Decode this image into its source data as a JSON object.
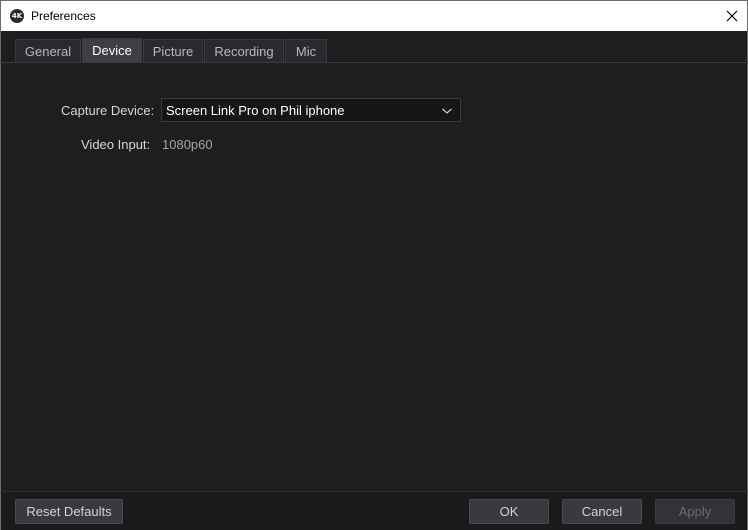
{
  "window": {
    "title": "Preferences",
    "app_icon_text": "4K"
  },
  "tabs": [
    {
      "label": "General",
      "active": false
    },
    {
      "label": "Device",
      "active": true
    },
    {
      "label": "Picture",
      "active": false
    },
    {
      "label": "Recording",
      "active": false
    },
    {
      "label": "Mic",
      "active": false
    }
  ],
  "device": {
    "capture_device_label": "Capture Device:",
    "capture_device_value": "Screen Link Pro on Phil iphone",
    "video_input_label": "Video Input:",
    "video_input_value": "1080p60"
  },
  "footer": {
    "reset_label": "Reset Defaults",
    "ok_label": "OK",
    "cancel_label": "Cancel",
    "apply_label": "Apply"
  },
  "colors": {
    "background": "#1e1e21",
    "button": "#3a3a3e",
    "active_tab": "#3e3e43"
  }
}
